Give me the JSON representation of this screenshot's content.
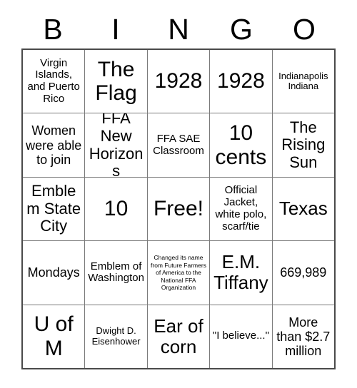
{
  "header": {
    "letters": [
      "B",
      "I",
      "N",
      "G",
      "O"
    ]
  },
  "grid": {
    "columns": 5,
    "rows": 5,
    "free_space_label": "Free!",
    "cells": [
      {
        "text": "Virgin Islands, and Puerto Rico",
        "size": "s"
      },
      {
        "text": "The Flag",
        "size": "xxl"
      },
      {
        "text": "1928",
        "size": "xxl"
      },
      {
        "text": "1928",
        "size": "xxl"
      },
      {
        "text": "Indianapolis Indiana",
        "size": "xs"
      },
      {
        "text": "Women were able to join",
        "size": "m"
      },
      {
        "text": "FFA New Horizons",
        "size": "l"
      },
      {
        "text": "FFA SAE Classroom",
        "size": "s"
      },
      {
        "text": "10 cents",
        "size": "xxl"
      },
      {
        "text": "The Rising Sun",
        "size": "l"
      },
      {
        "text": "Emblem State City",
        "size": "l"
      },
      {
        "text": "10",
        "size": "xxl"
      },
      {
        "text": "Free!",
        "size": "xxl"
      },
      {
        "text": "Official Jacket, white polo, scarf/tie",
        "size": "s"
      },
      {
        "text": "Texas",
        "size": "xl"
      },
      {
        "text": "Mondays",
        "size": "m"
      },
      {
        "text": "Emblem of Washington",
        "size": "s"
      },
      {
        "text": "Changed its name from Future Farmers of America to the National FFA Organization",
        "size": "xxs"
      },
      {
        "text": "E.M. Tiffany",
        "size": "xl"
      },
      {
        "text": "669,989",
        "size": "m"
      },
      {
        "text": "U of M",
        "size": "xxl"
      },
      {
        "text": "Dwight D. Eisenhower",
        "size": "xs"
      },
      {
        "text": "Ear of corn",
        "size": "xl"
      },
      {
        "text": "\"I believe...\"",
        "size": "s"
      },
      {
        "text": "More than $2.7 million",
        "size": "m"
      }
    ]
  },
  "colors": {
    "background": "#ffffff",
    "text": "#000000",
    "grid_line": "#7a7a7a",
    "grid_border": "#4a4a4a"
  }
}
